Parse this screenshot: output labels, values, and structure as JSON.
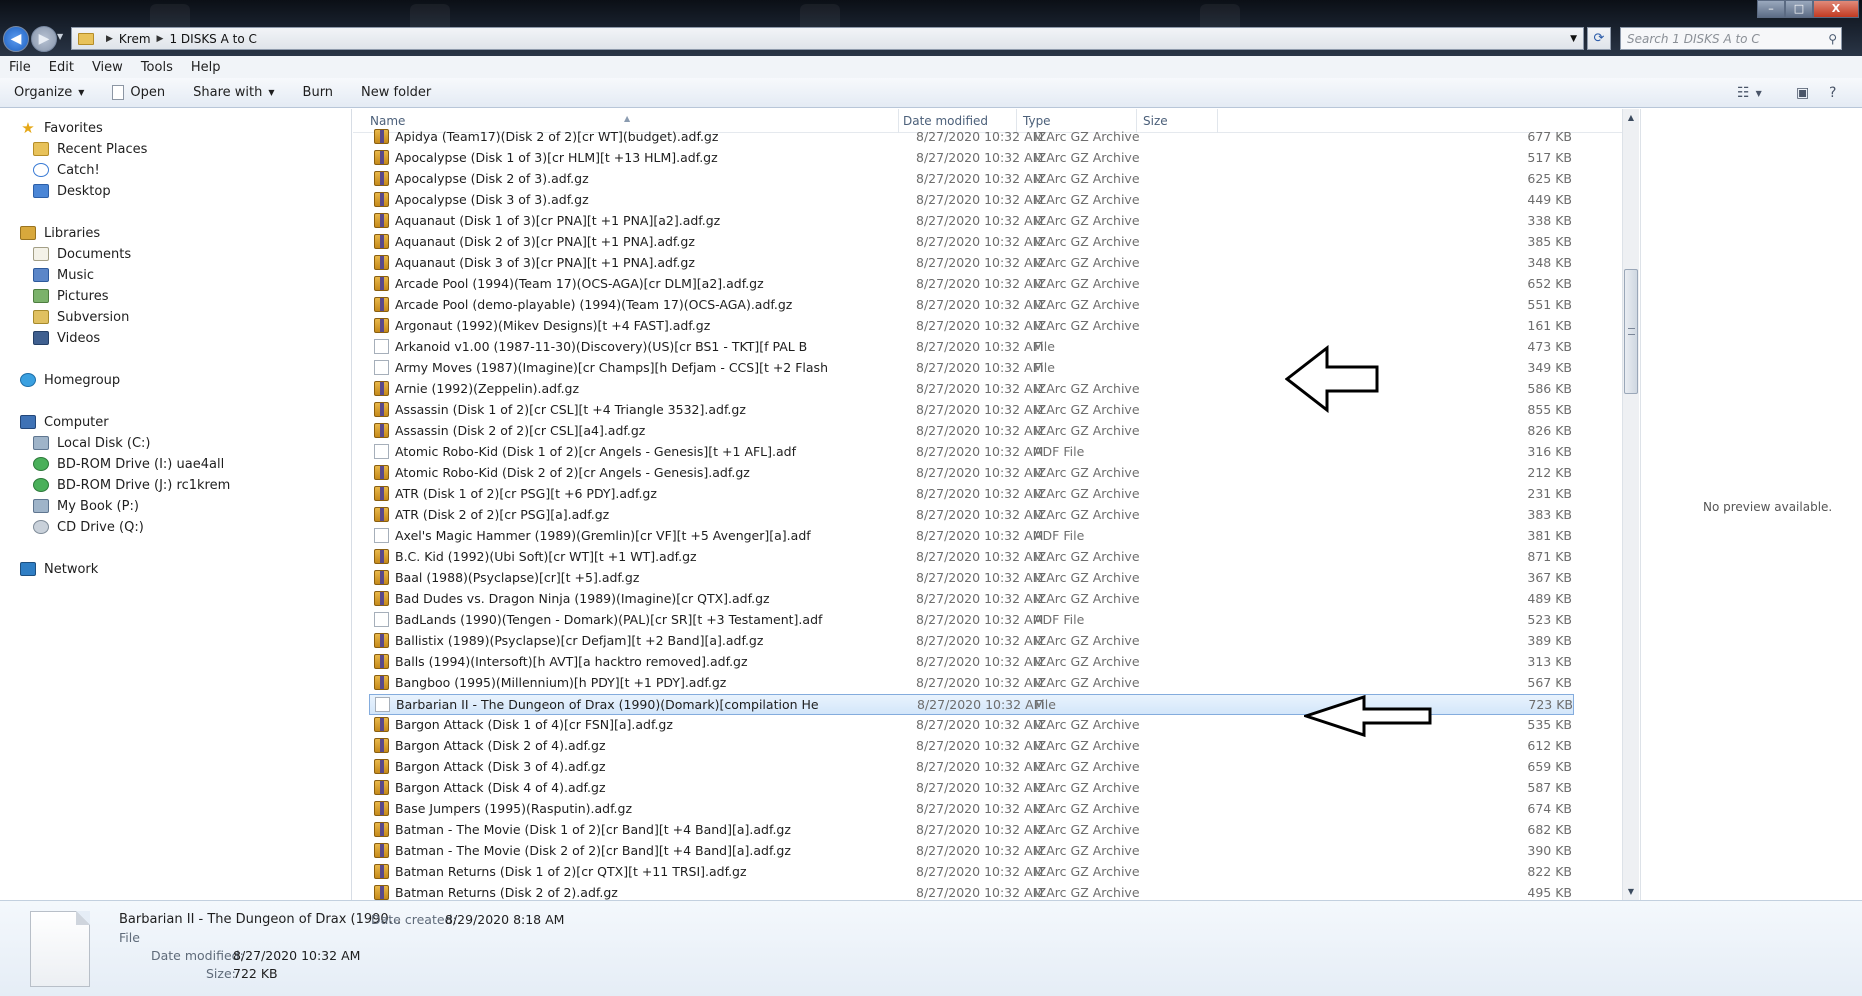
{
  "window": {
    "breadcrumb": [
      "Krem",
      "1 DISKS A to C"
    ],
    "search_placeholder": "Search 1 DISKS A to C",
    "controls": {
      "minimize": "–",
      "maximize": "□",
      "close": "X"
    }
  },
  "menu": [
    "File",
    "Edit",
    "View",
    "Tools",
    "Help"
  ],
  "toolbar": {
    "organize": "Organize",
    "open": "Open",
    "share_with": "Share with",
    "burn": "Burn",
    "new_folder": "New folder"
  },
  "nav": {
    "favorites": {
      "title": "Favorites",
      "items": [
        "Recent Places",
        "Catch!",
        "Desktop"
      ]
    },
    "libraries": {
      "title": "Libraries",
      "items": [
        "Documents",
        "Music",
        "Pictures",
        "Subversion",
        "Videos"
      ]
    },
    "homegroup": "Homegroup",
    "computer": {
      "title": "Computer",
      "items": [
        "Local Disk (C:)",
        "BD-ROM Drive (I:) uae4all",
        "BD-ROM Drive (J:) rc1krem",
        "My Book (P:)",
        "CD Drive (Q:)"
      ]
    },
    "network": "Network"
  },
  "columns": {
    "name": "Name",
    "date": "Date modified",
    "type": "Type",
    "size": "Size"
  },
  "files": [
    {
      "name": "Apidya (Team17)(Disk 2 of 2)[cr WT](budget).adf.gz",
      "date": "8/27/2020 10:32 AM",
      "type": "IZArc GZ Archive",
      "size": "677 KB",
      "icon": "archive-icon"
    },
    {
      "name": "Apocalypse (Disk 1 of 3)[cr HLM][t +13 HLM].adf.gz",
      "date": "8/27/2020 10:32 AM",
      "type": "IZArc GZ Archive",
      "size": "517 KB",
      "icon": "archive-icon"
    },
    {
      "name": "Apocalypse (Disk 2 of 3).adf.gz",
      "date": "8/27/2020 10:32 AM",
      "type": "IZArc GZ Archive",
      "size": "625 KB",
      "icon": "archive-icon"
    },
    {
      "name": "Apocalypse (Disk 3 of 3).adf.gz",
      "date": "8/27/2020 10:32 AM",
      "type": "IZArc GZ Archive",
      "size": "449 KB",
      "icon": "archive-icon"
    },
    {
      "name": "Aquanaut (Disk 1 of 3)[cr PNA][t +1 PNA][a2].adf.gz",
      "date": "8/27/2020 10:32 AM",
      "type": "IZArc GZ Archive",
      "size": "338 KB",
      "icon": "archive-icon"
    },
    {
      "name": "Aquanaut (Disk 2 of 3)[cr PNA][t +1 PNA].adf.gz",
      "date": "8/27/2020 10:32 AM",
      "type": "IZArc GZ Archive",
      "size": "385 KB",
      "icon": "archive-icon"
    },
    {
      "name": "Aquanaut (Disk 3 of 3)[cr PNA][t +1 PNA].adf.gz",
      "date": "8/27/2020 10:32 AM",
      "type": "IZArc GZ Archive",
      "size": "348 KB",
      "icon": "archive-icon"
    },
    {
      "name": "Arcade Pool (1994)(Team 17)(OCS-AGA)[cr DLM][a2].adf.gz",
      "date": "8/27/2020 10:32 AM",
      "type": "IZArc GZ Archive",
      "size": "652 KB",
      "icon": "archive-icon"
    },
    {
      "name": "Arcade Pool (demo-playable) (1994)(Team 17)(OCS-AGA).adf.gz",
      "date": "8/27/2020 10:32 AM",
      "type": "IZArc GZ Archive",
      "size": "551 KB",
      "icon": "archive-icon"
    },
    {
      "name": "Argonaut (1992)(Mikev Designs)[t +4 FAST].adf.gz",
      "date": "8/27/2020 10:32 AM",
      "type": "IZArc GZ Archive",
      "size": "161 KB",
      "icon": "archive-icon"
    },
    {
      "name": "Arkanoid v1.00 (1987-11-30)(Discovery)(US)[cr BS1 - TKT][f PAL B",
      "date": "8/27/2020 10:32 AM",
      "type": "File",
      "size": "473 KB",
      "icon": "file-icon"
    },
    {
      "name": "Army Moves (1987)(Imagine)[cr Champs][h Defjam - CCS][t +2 Flash",
      "date": "8/27/2020 10:32 AM",
      "type": "File",
      "size": "349 KB",
      "icon": "file-icon"
    },
    {
      "name": "Arnie (1992)(Zeppelin).adf.gz",
      "date": "8/27/2020 10:32 AM",
      "type": "IZArc GZ Archive",
      "size": "586 KB",
      "icon": "archive-icon"
    },
    {
      "name": "Assassin (Disk 1 of 2)[cr CSL][t +4 Triangle 3532].adf.gz",
      "date": "8/27/2020 10:32 AM",
      "type": "IZArc GZ Archive",
      "size": "855 KB",
      "icon": "archive-icon"
    },
    {
      "name": "Assassin (Disk 2 of 2)[cr CSL][a4].adf.gz",
      "date": "8/27/2020 10:32 AM",
      "type": "IZArc GZ Archive",
      "size": "826 KB",
      "icon": "archive-icon"
    },
    {
      "name": "Atomic Robo-Kid (Disk 1 of 2)[cr Angels - Genesis][t +1 AFL].adf",
      "date": "8/27/2020 10:32 AM",
      "type": "ADF File",
      "size": "316 KB",
      "icon": "file-icon"
    },
    {
      "name": "Atomic Robo-Kid (Disk 2 of 2)[cr Angels - Genesis].adf.gz",
      "date": "8/27/2020 10:32 AM",
      "type": "IZArc GZ Archive",
      "size": "212 KB",
      "icon": "archive-icon"
    },
    {
      "name": "ATR (Disk 1 of 2)[cr PSG][t +6 PDY].adf.gz",
      "date": "8/27/2020 10:32 AM",
      "type": "IZArc GZ Archive",
      "size": "231 KB",
      "icon": "archive-icon"
    },
    {
      "name": "ATR (Disk 2 of 2)[cr PSG][a].adf.gz",
      "date": "8/27/2020 10:32 AM",
      "type": "IZArc GZ Archive",
      "size": "383 KB",
      "icon": "archive-icon"
    },
    {
      "name": "Axel's Magic Hammer (1989)(Gremlin)[cr VF][t +5 Avenger][a].adf",
      "date": "8/27/2020 10:32 AM",
      "type": "ADF File",
      "size": "381 KB",
      "icon": "file-icon"
    },
    {
      "name": "B.C. Kid (1992)(Ubi Soft)[cr WT][t +1 WT].adf.gz",
      "date": "8/27/2020 10:32 AM",
      "type": "IZArc GZ Archive",
      "size": "871 KB",
      "icon": "archive-icon"
    },
    {
      "name": "Baal (1988)(Psyclapse)[cr][t +5].adf.gz",
      "date": "8/27/2020 10:32 AM",
      "type": "IZArc GZ Archive",
      "size": "367 KB",
      "icon": "archive-icon"
    },
    {
      "name": "Bad Dudes vs. Dragon Ninja (1989)(Imagine)[cr QTX].adf.gz",
      "date": "8/27/2020 10:32 AM",
      "type": "IZArc GZ Archive",
      "size": "489 KB",
      "icon": "archive-icon"
    },
    {
      "name": "BadLands (1990)(Tengen - Domark)(PAL)[cr SR][t +3 Testament].adf",
      "date": "8/27/2020 10:32 AM",
      "type": "ADF File",
      "size": "523 KB",
      "icon": "file-icon"
    },
    {
      "name": "Ballistix (1989)(Psyclapse)[cr Defjam][t +2 Band][a].adf.gz",
      "date": "8/27/2020 10:32 AM",
      "type": "IZArc GZ Archive",
      "size": "389 KB",
      "icon": "archive-icon"
    },
    {
      "name": "Balls (1994)(Intersoft)[h AVT][a hacktro removed].adf.gz",
      "date": "8/27/2020 10:32 AM",
      "type": "IZArc GZ Archive",
      "size": "313 KB",
      "icon": "archive-icon"
    },
    {
      "name": "Bangboo (1995)(Millennium)[h PDY][t +1 PDY].adf.gz",
      "date": "8/27/2020 10:32 AM",
      "type": "IZArc GZ Archive",
      "size": "567 KB",
      "icon": "archive-icon"
    },
    {
      "name": "Barbarian II - The Dungeon of Drax (1990)(Domark)[compilation He",
      "date": "8/27/2020 10:32 AM",
      "type": "File",
      "size": "723 KB",
      "icon": "file-icon",
      "selected": true
    },
    {
      "name": "Bargon Attack (Disk 1 of 4)[cr FSN][a].adf.gz",
      "date": "8/27/2020 10:32 AM",
      "type": "IZArc GZ Archive",
      "size": "535 KB",
      "icon": "archive-icon"
    },
    {
      "name": "Bargon Attack (Disk 2 of 4).adf.gz",
      "date": "8/27/2020 10:32 AM",
      "type": "IZArc GZ Archive",
      "size": "612 KB",
      "icon": "archive-icon"
    },
    {
      "name": "Bargon Attack (Disk 3 of 4).adf.gz",
      "date": "8/27/2020 10:32 AM",
      "type": "IZArc GZ Archive",
      "size": "659 KB",
      "icon": "archive-icon"
    },
    {
      "name": "Bargon Attack (Disk 4 of 4).adf.gz",
      "date": "8/27/2020 10:32 AM",
      "type": "IZArc GZ Archive",
      "size": "587 KB",
      "icon": "archive-icon"
    },
    {
      "name": "Base Jumpers (1995)(Rasputin).adf.gz",
      "date": "8/27/2020 10:32 AM",
      "type": "IZArc GZ Archive",
      "size": "674 KB",
      "icon": "archive-icon"
    },
    {
      "name": "Batman - The Movie (Disk 1 of 2)[cr Band][t +4 Band][a].adf.gz",
      "date": "8/27/2020 10:32 AM",
      "type": "IZArc GZ Archive",
      "size": "682 KB",
      "icon": "archive-icon"
    },
    {
      "name": "Batman - The Movie (Disk 2 of 2)[cr Band][t +4 Band][a].adf.gz",
      "date": "8/27/2020 10:32 AM",
      "type": "IZArc GZ Archive",
      "size": "390 KB",
      "icon": "archive-icon"
    },
    {
      "name": "Batman Returns (Disk 1 of 2)[cr QTX][t +11 TRSI].adf.gz",
      "date": "8/27/2020 10:32 AM",
      "type": "IZArc GZ Archive",
      "size": "822 KB",
      "icon": "archive-icon"
    },
    {
      "name": "Batman Returns (Disk 2 of 2).adf.gz",
      "date": "8/27/2020 10:32 AM",
      "type": "IZArc GZ Archive",
      "size": "495 KB",
      "icon": "archive-icon"
    }
  ],
  "preview": {
    "text": "No preview available."
  },
  "details": {
    "name": "Barbarian II - The Dungeon of Drax (1990...",
    "type": "File",
    "date_modified_label": "Date modified:",
    "date_modified": "8/27/2020 10:32 AM",
    "size_label": "Size:",
    "size": "722 KB",
    "date_created_label": "Date created:",
    "date_created": "8/29/2020 8:18 AM"
  }
}
